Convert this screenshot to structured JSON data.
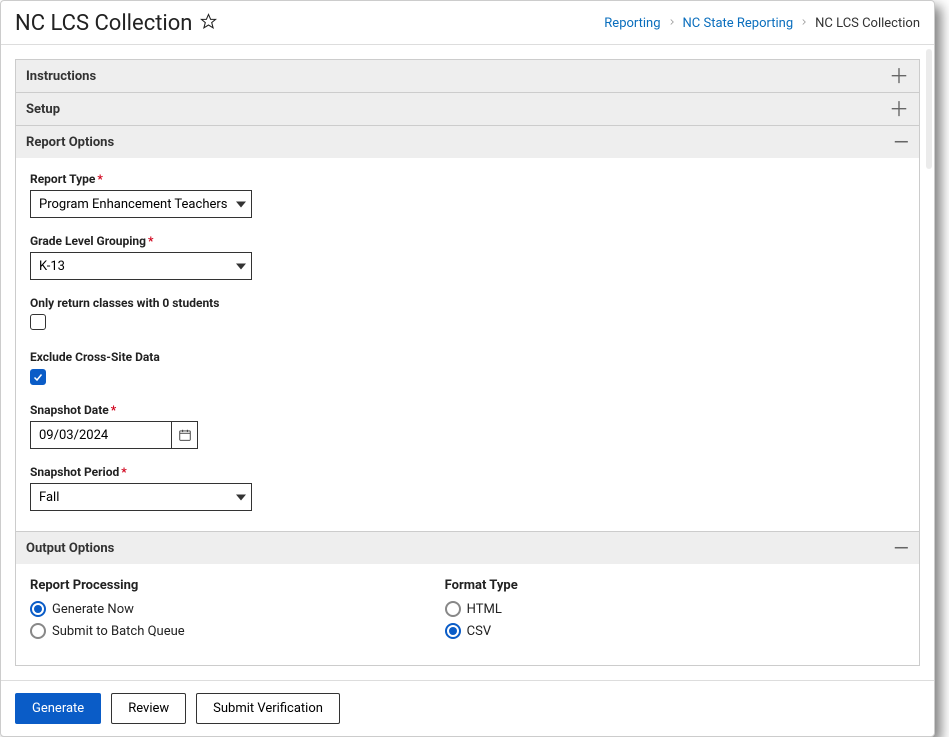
{
  "header": {
    "title": "NC LCS Collection",
    "breadcrumb": {
      "items": [
        {
          "label": "Reporting",
          "link": true
        },
        {
          "label": "NC State Reporting",
          "link": true
        },
        {
          "label": "NC LCS Collection",
          "link": false
        }
      ]
    }
  },
  "sections": {
    "instructions": {
      "title": "Instructions",
      "expanded": false
    },
    "setup": {
      "title": "Setup",
      "expanded": false
    },
    "report_options": {
      "title": "Report Options",
      "expanded": true,
      "fields": {
        "report_type": {
          "label": "Report Type",
          "value": "Program Enhancement Teachers",
          "required": true
        },
        "grade_level_grouping": {
          "label": "Grade Level Grouping",
          "value": "K-13",
          "required": true
        },
        "only_zero_students": {
          "label": "Only return classes with 0 students",
          "checked": false
        },
        "exclude_cross_site": {
          "label": "Exclude Cross-Site Data",
          "checked": true
        },
        "snapshot_date": {
          "label": "Snapshot Date",
          "value": "09/03/2024",
          "required": true
        },
        "snapshot_period": {
          "label": "Snapshot Period",
          "value": "Fall",
          "required": true
        }
      }
    },
    "output_options": {
      "title": "Output Options",
      "expanded": true,
      "report_processing": {
        "label": "Report Processing",
        "options": [
          {
            "label": "Generate Now",
            "selected": true
          },
          {
            "label": "Submit to Batch Queue",
            "selected": false
          }
        ]
      },
      "format_type": {
        "label": "Format Type",
        "options": [
          {
            "label": "HTML",
            "selected": false
          },
          {
            "label": "CSV",
            "selected": true
          }
        ]
      }
    }
  },
  "footer": {
    "generate": "Generate",
    "review": "Review",
    "submit_verification": "Submit Verification"
  }
}
